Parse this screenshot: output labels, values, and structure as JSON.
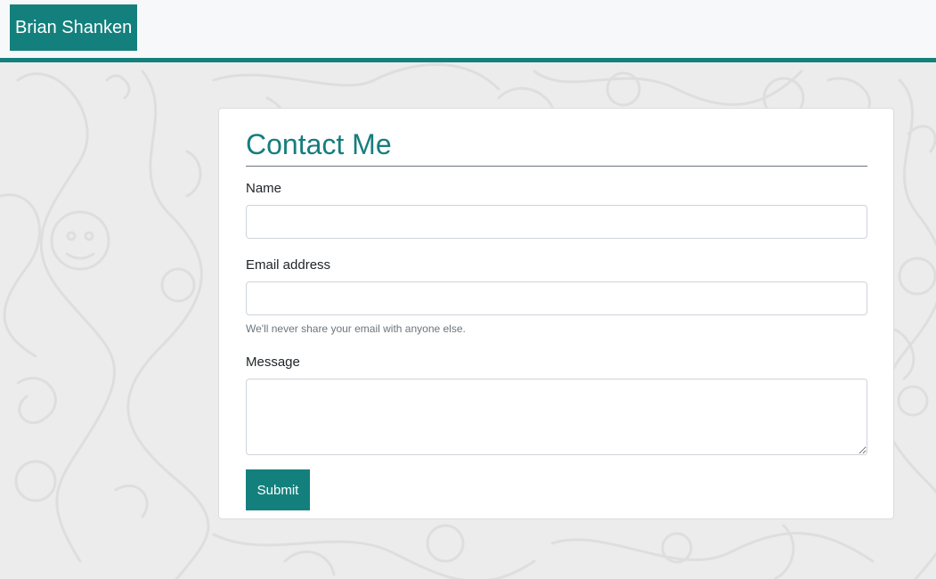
{
  "navbar": {
    "brand": "Brian Shanken"
  },
  "contact": {
    "title": "Contact Me",
    "name_label": "Name",
    "name_value": "",
    "email_label": "Email address",
    "email_value": "",
    "email_help": "We'll never share your email with anyone else.",
    "message_label": "Message",
    "message_value": "",
    "submit_label": "Submit"
  },
  "colors": {
    "accent": "#14807d",
    "title": "#167d7e",
    "page_background": "#ececec",
    "navbar_background": "#f7f8fa"
  }
}
